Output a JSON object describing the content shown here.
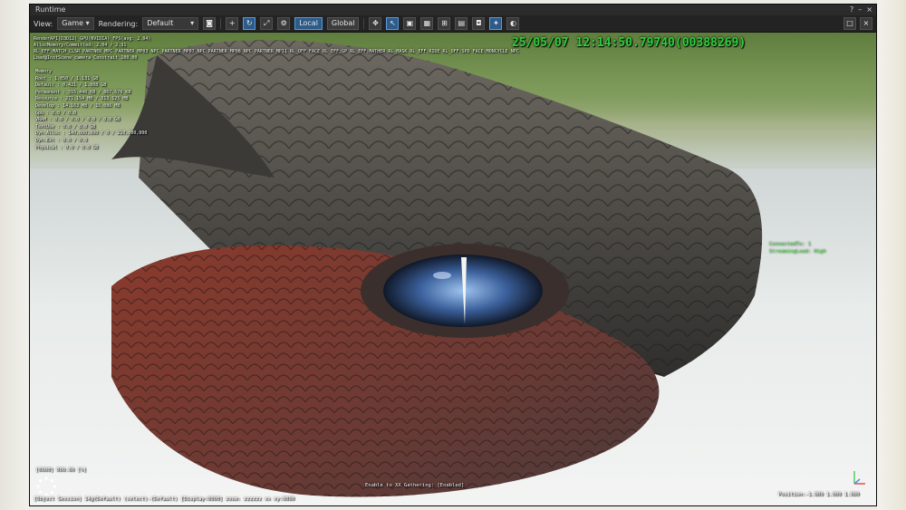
{
  "window": {
    "title": "Runtime",
    "help": "?",
    "minimize": "–",
    "close": "×"
  },
  "toolbar": {
    "view_label": "View:",
    "view_value": "Game",
    "rendering_label": "Rendering:",
    "rendering_value": "Default",
    "local": "Local",
    "global": "Global",
    "icons": [
      "camera-icon",
      "plus-icon",
      "rotate-icon",
      "expand-icon",
      "settings-icon",
      "move-icon",
      "select-icon",
      "gizmo-icon",
      "grid-icon",
      "snap-icon",
      "image-icon",
      "screenshot-icon",
      "light-icon",
      "view-icon"
    ]
  },
  "overlay": {
    "timestamp": "25/05/07  12:14:50.79740(00388269)",
    "header_line_1": "RenderAPI(D3D12) GPU(NVIDIA) FPS(avg: 2.04)",
    "header_line_2": "AllocMemory/Committed: 2.04 / 2.31",
    "header_line_3": "RL_EFF:MATCH_CLSR  PARTNER MPC  PARTNER MP03  NPC PARTNER MP07  NPC PARTNER MP08  NPC PARTNER MP11  RL_OFF  FACE  RL_EFF:GP  RL_EFF:MATHER  RL_MASK  RL_EFF:RIDE  RL_OFF:SPD  FACE:MONCYCLE  NPC",
    "header_line_4": "Load@InstScene  camera  Constrait  100.00",
    "memory_title": "Memory",
    "stats": [
      {
        "label": "Root",
        "value": "1.050 / 1.131 GB"
      },
      {
        "label": "Default",
        "value": "0.421 / 1.008 GB"
      },
      {
        "label": "Permanent",
        "value": "555.448 KB / 867.576 KB"
      },
      {
        "label": "Resource",
        "value": "271.154 MB / 313.125 MB"
      },
      {
        "label": "Develop",
        "value": "14.163 MB / 15.086 MB"
      },
      {
        "label": "Gpu",
        "value": "0.0 / 0.0"
      },
      {
        "label": "VRAM",
        "value": "0.0 / 0.0 / 0.0 / 0.0 GB"
      },
      {
        "label": "TextUse",
        "value": "0.0 / 0.0 GB"
      },
      {
        "label": "Dyn.Alloc",
        "value": "140,000,000 / 0 / 210,000,000"
      },
      {
        "label": "Dyn.Ext",
        "value": "0.0 / 0.0"
      },
      {
        "label": "Physical",
        "value": "0.0 / 0.0 GB"
      }
    ],
    "side_lines": [
      "ConnectedTo: 1",
      "StreamingLoad: High"
    ],
    "bottom_left_line_1": "[0000] 000.00 [%]",
    "bottom_left_line_2": "[Object Session] 14@(Default) (select)-(Default)  [Display:0000] zoom: zzzzzz  xx  xy:0000",
    "bottom_mid_line": "Enable to XX  Gathering: [Enabled]",
    "bottom_right_line": "Position:-1.000  1.000  1.000"
  },
  "colors": {
    "hud_green": "#2bd13a",
    "hud_white": "#f2f2f2",
    "toolbar_active": "#2d5b8a"
  }
}
